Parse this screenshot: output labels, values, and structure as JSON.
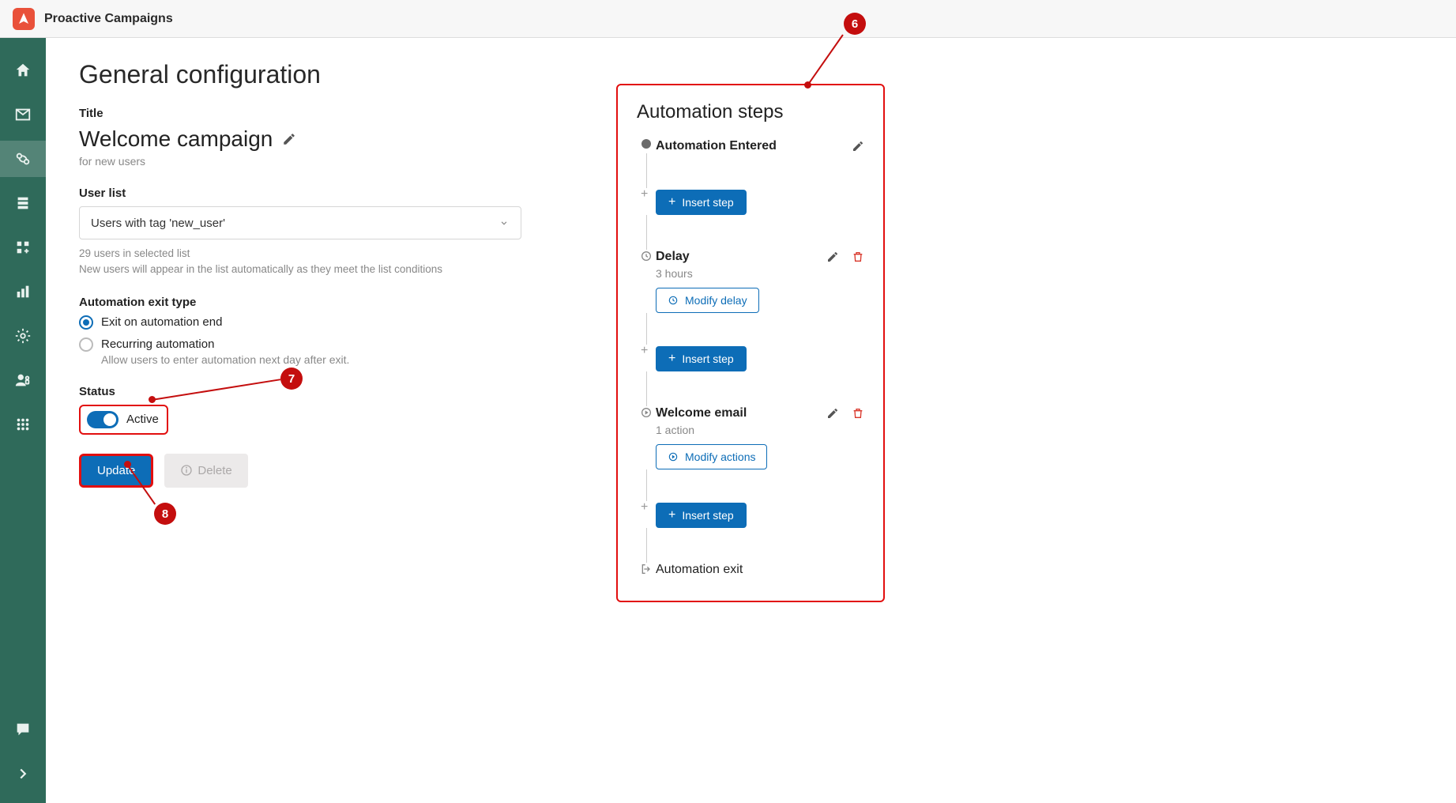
{
  "app": {
    "title": "Proactive Campaigns"
  },
  "page": {
    "heading": "General configuration",
    "title_label": "Title",
    "campaign_title": "Welcome campaign",
    "campaign_subtitle": "for new users",
    "userlist_label": "User list",
    "userlist_value": "Users with tag 'new_user'",
    "userlist_help1": "29 users in selected list",
    "userlist_help2": "New users will appear in the list automatically as they meet the list conditions",
    "exit_label": "Automation exit type",
    "exit_opt1": "Exit on automation end",
    "exit_opt2": "Recurring automation",
    "exit_opt2_sub": "Allow users to enter automation next day after exit.",
    "status_label": "Status",
    "status_value": "Active",
    "update_btn": "Update",
    "delete_btn": "Delete"
  },
  "automation": {
    "heading": "Automation steps",
    "entered": "Automation Entered",
    "insert": "Insert step",
    "delay_title": "Delay",
    "delay_value": "3 hours",
    "modify_delay": "Modify delay",
    "welcome_title": "Welcome email",
    "welcome_sub": "1 action",
    "modify_actions": "Modify actions",
    "exit": "Automation exit"
  },
  "callouts": {
    "c6": "6",
    "c7": "7",
    "c8": "8"
  }
}
